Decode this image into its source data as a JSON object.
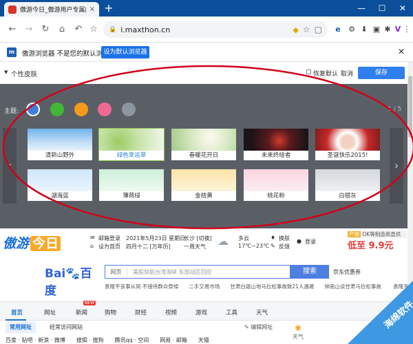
{
  "tab": {
    "title": "傲游今日_傲游用户专属的网址导",
    "close": "×"
  },
  "newtab": "+",
  "window_controls": {
    "minimize": "—",
    "maximize": "☐",
    "close": "✕"
  },
  "toolbar": {
    "back": "←",
    "forward": "→",
    "reload": "↻",
    "home": "⌂",
    "undo": "↶",
    "bookmark": "☆",
    "url": "i.maxthon.cn",
    "icons": [
      "e",
      "⚙",
      "⬇",
      "▣",
      "✱",
      "V",
      "⋮"
    ]
  },
  "infobar": {
    "logo": "m",
    "message": "傲游浏览器 不是您的默认浏览器",
    "button": "设为默认浏览器",
    "close": "✕"
  },
  "skin_header": {
    "label": "个性皮肤",
    "reset": "恢复默认",
    "cancel": "取消",
    "save": "保存"
  },
  "skin_panel": {
    "theme_label": "主题:",
    "pager": "1 / 5",
    "swatch_colors": [
      "#3f7fd8",
      "#41b735",
      "#f59a1a",
      "#ef6a93",
      "#8e969f"
    ],
    "cards_row1": [
      {
        "caption": "清新山野外",
        "caption_color": "#333333"
      },
      {
        "caption": "绿色幸运草",
        "caption_color": "#2a7de1"
      },
      {
        "caption": "春暖花开日",
        "caption_color": "#333333"
      },
      {
        "caption": "未来终结者",
        "caption_color": "#333333"
      },
      {
        "caption": "圣诞快乐2015!",
        "caption_color": "#333333"
      }
    ],
    "cards_row2": [
      {
        "caption": "湖海蓝"
      },
      {
        "caption": "薄荷绿"
      },
      {
        "caption": "金桔黄"
      },
      {
        "caption": "桃花粉"
      },
      {
        "caption": "白银灰"
      }
    ]
  },
  "home": {
    "brand": "傲游",
    "brand_today": "今日",
    "quick": [
      "邮箱登录",
      "设为首页"
    ],
    "date": "2021年5月23日 星期日",
    "lunar": "四月十二 [万年历]",
    "city": "长沙 [切换]",
    "weather_desc": "一周天气",
    "weather": "多云",
    "temp": "17℃~23℃",
    "skin": "换肤",
    "feedback": "反馈",
    "login": "登录",
    "ad_tag": "产地",
    "ad_desc": "OK等制造商直供",
    "ad_price": "低至 9.9元",
    "search_select": "网页",
    "search_placeholder": "美股穿航台湾海峡 东部战区回应",
    "search_button": "搜索",
    "jd": "京东优惠券",
    "hotlinks": "袁隆平丧事从简 不接待群众祭悼　　二手交易市场　　甘肃白银山地马拉松事故致21人遇难　　钟南山谈甘肃马拉松事故 　　袁隆平"
  },
  "nav": [
    "首页",
    "网址",
    "新闻",
    "购物",
    "财经",
    "视频",
    "游戏",
    "工具",
    "天气"
  ],
  "new_badge": "NEW",
  "subtabs": [
    "常用网址",
    "经常访问网站"
  ],
  "edit_site": "编辑网址",
  "bottom_links": "百度 · 贴吧 · 新浪 · 微博　　搜狐 · 搜狗　　腾讯qq · 空间　　网易 · 邮箱　　天猫",
  "weather_small": "天气",
  "watermark": "海绵软件"
}
